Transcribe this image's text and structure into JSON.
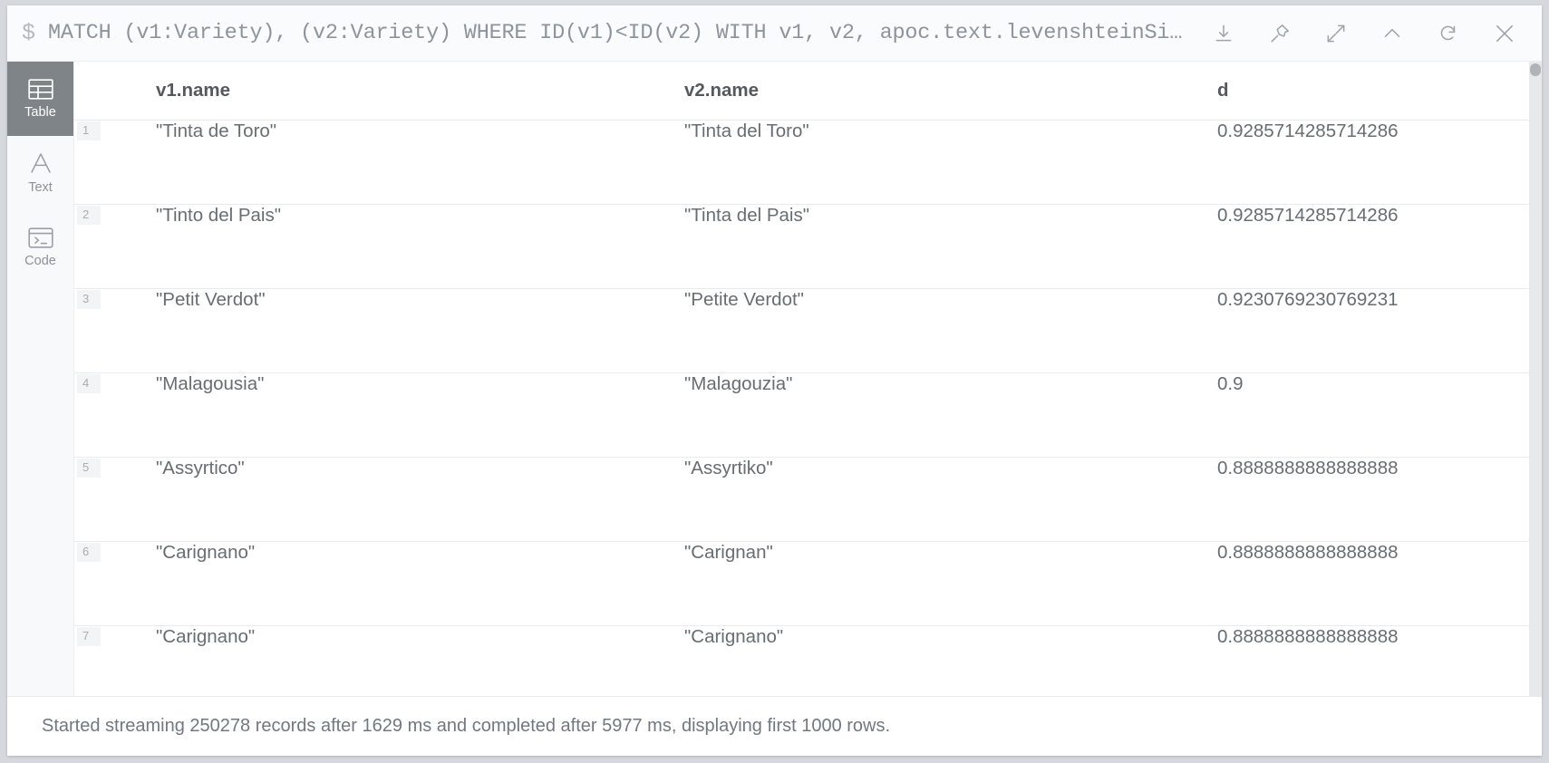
{
  "query_bar": {
    "prompt": "$",
    "query": "MATCH (v1:Variety), (v2:Variety) WHERE ID(v1)<ID(v2) WITH v1, v2, apoc.text.levenshteinSi…",
    "actions": [
      {
        "name": "download-icon",
        "label": "Download"
      },
      {
        "name": "pin-icon",
        "label": "Pin"
      },
      {
        "name": "expand-icon",
        "label": "Expand"
      },
      {
        "name": "chevron-up-icon",
        "label": "Collapse"
      },
      {
        "name": "refresh-icon",
        "label": "Rerun"
      },
      {
        "name": "close-icon",
        "label": "Close"
      }
    ]
  },
  "view_switcher": {
    "items": [
      {
        "label": "Table",
        "icon": "table-icon",
        "active": true
      },
      {
        "label": "Text",
        "icon": "text-icon",
        "active": false
      },
      {
        "label": "Code",
        "icon": "code-icon",
        "active": false
      }
    ]
  },
  "results_table": {
    "columns": [
      "v1.name",
      "v2.name",
      "d"
    ],
    "rows": [
      {
        "n": "1",
        "v1": "\"Tinta de Toro\"",
        "v2": "\"Tinta del Toro\"",
        "d": "0.9285714285714286"
      },
      {
        "n": "2",
        "v1": "\"Tinto del Pais\"",
        "v2": "\"Tinta del Pais\"",
        "d": "0.9285714285714286"
      },
      {
        "n": "3",
        "v1": "\"Petit Verdot\"",
        "v2": "\"Petite Verdot\"",
        "d": "0.9230769230769231"
      },
      {
        "n": "4",
        "v1": "\"Malagousia\"",
        "v2": "\"Malagouzia\"",
        "d": "0.9"
      },
      {
        "n": "5",
        "v1": "\"Assyrtico\"",
        "v2": "\"Assyrtiko\"",
        "d": "0.8888888888888888"
      },
      {
        "n": "6",
        "v1": "\"Carignano\"",
        "v2": "\"Carignan\"",
        "d": "0.8888888888888888"
      },
      {
        "n": "7",
        "v1": "\"Carignano\"",
        "v2": "\"Carignano\"",
        "d": "0.8888888888888888"
      }
    ]
  },
  "status_bar": {
    "message": "Started streaming 250278 records after 1629 ms and completed after 5977 ms, displaying first 1000 rows."
  },
  "colors": {
    "page_background": "#d5d9de",
    "panel_background": "#ffffff",
    "query_bar_background": "#fafbfc",
    "active_view_background": "#7f8488",
    "text_muted": "#8d949b",
    "text_body": "#686d72",
    "row_badge_background": "#f3f4f5"
  }
}
